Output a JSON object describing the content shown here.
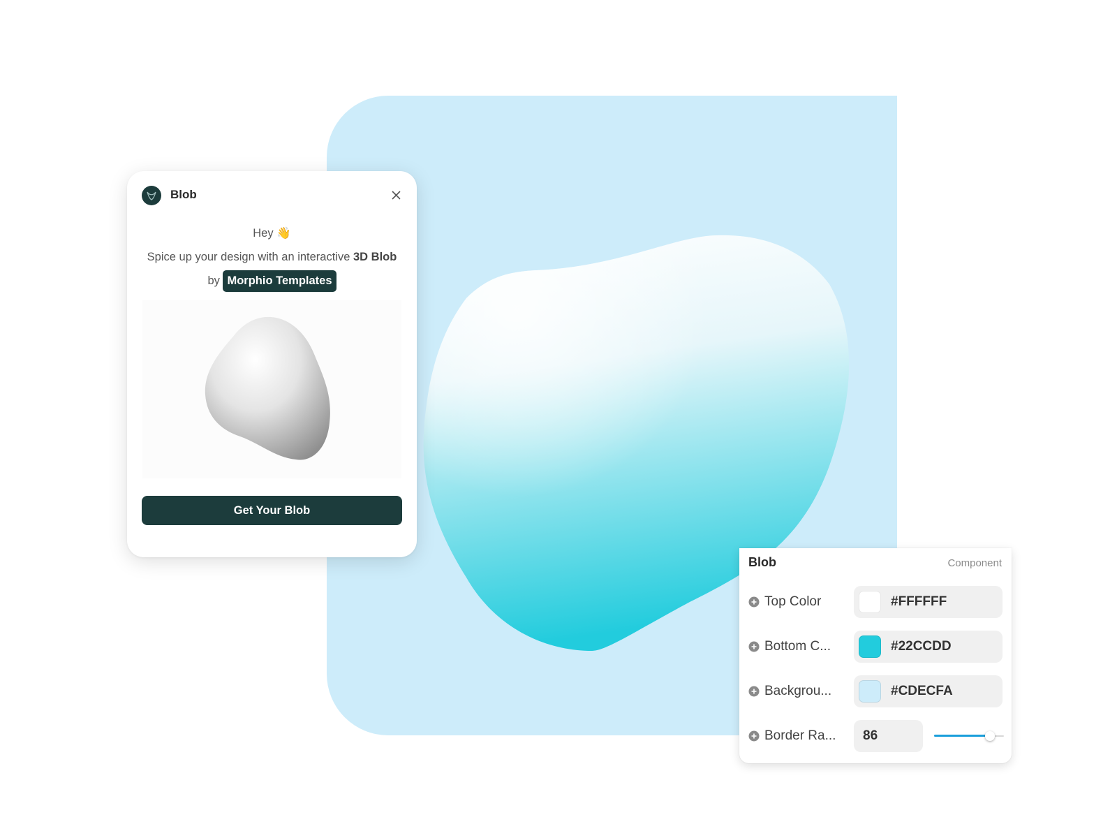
{
  "canvas": {
    "background_color": "#CDECFA",
    "blob_top_color": "#FFFFFF",
    "blob_bottom_color": "#22CCDD"
  },
  "popup": {
    "title": "Blob",
    "logo_icon": "morphio-logo-icon",
    "close_icon": "close-icon",
    "greeting": "Hey 👋",
    "text_intro": "Spice up your design with an interactive",
    "text_bold": "3D Blob",
    "text_by": "by",
    "brand": "Morphio Templates",
    "cta_label": "Get Your Blob"
  },
  "properties": {
    "title": "Blob",
    "type_label": "Component",
    "rows": [
      {
        "label": "Top Color",
        "value": "#FFFFFF",
        "swatch": "#FFFFFF"
      },
      {
        "label": "Bottom C...",
        "value": "#22CCDD",
        "swatch": "#22CCDD"
      },
      {
        "label": "Backgrou...",
        "value": "#CDECFA",
        "swatch": "#CDECFA"
      }
    ],
    "border_radius": {
      "label": "Border Ra...",
      "value": "86",
      "slider_fraction": 0.8
    }
  }
}
